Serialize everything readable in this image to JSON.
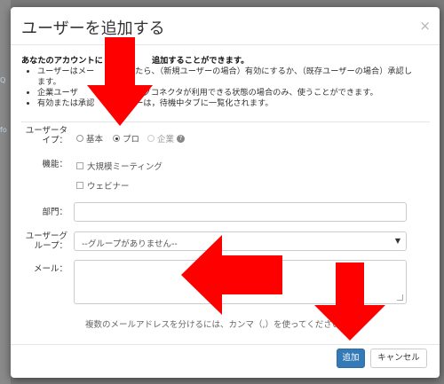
{
  "background": {
    "fragments": [
      "Q",
      "fo"
    ]
  },
  "modal": {
    "title": "ユーザーを追加する",
    "close_glyph": "×"
  },
  "intro": {
    "title": "あなたのアカウントに　　　　　　追加することができます。",
    "bullets": [
      "ユーザーはメー　　　　　たら、（新規ユーザーの場合）有効にするか、（既存ユーザーの場合）承認し",
      "ます。",
      "企業ユーザ　　　　　ティングコネクタが利用できる状態の場合のみ、使うことができます。",
      "有効または承認　　　　ザーは，待機中タブに一覧化されます。"
    ]
  },
  "form": {
    "user_type": {
      "label": "ユーザータイプ：",
      "options": [
        {
          "label": "基本",
          "checked": false,
          "disabled": false
        },
        {
          "label": "プロ",
          "checked": true,
          "disabled": false
        },
        {
          "label": "企業",
          "checked": false,
          "disabled": true
        }
      ]
    },
    "features": {
      "label": "機能：",
      "options": [
        "大規模ミーティング",
        "ウェビナー"
      ]
    },
    "department": {
      "label": "部門：",
      "value": ""
    },
    "user_group": {
      "label": "ユーザーグループ：",
      "value": "--グループがありません--"
    },
    "email": {
      "label": "メール：",
      "value": "",
      "help": "複数のメールアドレスを分けるには、カンマ（,）を使ってください。"
    }
  },
  "buttons": {
    "add": "追加",
    "cancel": "キャンセル"
  },
  "colors": {
    "primary": "#337ab7",
    "arrow": "#ff0000"
  }
}
